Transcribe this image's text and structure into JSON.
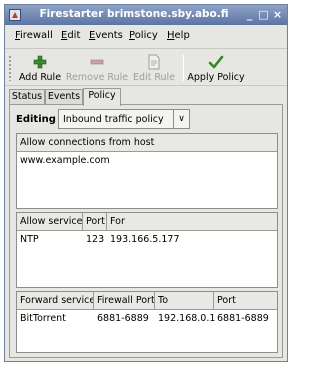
{
  "window": {
    "title": "Firestarter brimstone.sby.abo.fi",
    "controls": {
      "minimize": "_",
      "maximize": "□",
      "close": "×"
    }
  },
  "menu": [
    {
      "first": "F",
      "rest": "irewall"
    },
    {
      "first": "E",
      "rest": "dit"
    },
    {
      "first": "E",
      "rest": "vents"
    },
    {
      "first": "P",
      "rest": "olicy"
    },
    {
      "first": "H",
      "rest": "elp"
    }
  ],
  "toolbar": {
    "add_rule": "Add Rule",
    "remove_rule": "Remove Rule",
    "edit_rule": "Edit Rule",
    "apply_policy": "Apply Policy"
  },
  "tabs": [
    "Status",
    "Events",
    "Policy"
  ],
  "policy": {
    "editing_label": "Editing",
    "selected_policy": "Inbound traffic policy",
    "allow_hosts": {
      "header": "Allow connections from host",
      "rows": [
        "www.example.com"
      ]
    },
    "allow_services": {
      "headers": [
        "Allow service",
        "Port",
        "For"
      ],
      "rows": [
        [
          "NTP",
          "123",
          "193.166.5.177"
        ]
      ]
    },
    "forward_services": {
      "headers": [
        "Forward service",
        "Firewall Port",
        "To",
        "Port"
      ],
      "rows": [
        [
          "BitTorrent",
          "6881-6889",
          "192.168.0.1",
          "6881-6889"
        ]
      ]
    }
  }
}
